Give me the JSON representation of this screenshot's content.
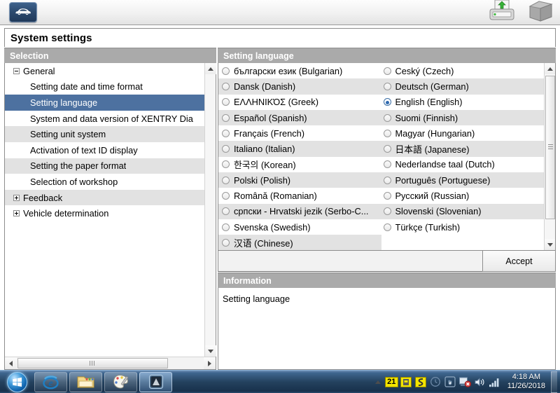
{
  "toolbar": {
    "car_icon": "car-icon",
    "print_icon": "printer-upload-icon",
    "book_icon": "book-icon"
  },
  "page": {
    "title": "System settings"
  },
  "headers": {
    "selection": "Selection",
    "setting_language": "Setting language",
    "information": "Information"
  },
  "tree": {
    "items": [
      {
        "label": "General",
        "level": 0,
        "expander": "minus",
        "selected": false,
        "alt": false
      },
      {
        "label": "Setting date and time format",
        "level": 1,
        "expander": "none",
        "selected": false,
        "alt": false
      },
      {
        "label": "Setting language",
        "level": 1,
        "expander": "none",
        "selected": true,
        "alt": false
      },
      {
        "label": "System and data version of XENTRY Dia",
        "level": 1,
        "expander": "none",
        "selected": false,
        "alt": false
      },
      {
        "label": "Setting unit system",
        "level": 1,
        "expander": "none",
        "selected": false,
        "alt": true
      },
      {
        "label": "Activation of text ID display",
        "level": 1,
        "expander": "none",
        "selected": false,
        "alt": false
      },
      {
        "label": "Setting the paper format",
        "level": 1,
        "expander": "none",
        "selected": false,
        "alt": true
      },
      {
        "label": "Selection of workshop",
        "level": 1,
        "expander": "none",
        "selected": false,
        "alt": false
      },
      {
        "label": "Feedback",
        "level": 0,
        "expander": "plus",
        "selected": false,
        "alt": true
      },
      {
        "label": "Vehicle determination",
        "level": 0,
        "expander": "plus",
        "selected": false,
        "alt": false
      }
    ]
  },
  "languages": {
    "rows": [
      {
        "alt": false,
        "left": {
          "label": "български език (Bulgarian)",
          "selected": false
        },
        "right": {
          "label": "Ceský (Czech)",
          "selected": false
        }
      },
      {
        "alt": true,
        "left": {
          "label": "Dansk (Danish)",
          "selected": false
        },
        "right": {
          "label": "Deutsch (German)",
          "selected": false
        }
      },
      {
        "alt": false,
        "left": {
          "label": "ΕΛΛΗΝΙΚΌΣ (Greek)",
          "selected": false
        },
        "right": {
          "label": "English (English)",
          "selected": true
        }
      },
      {
        "alt": true,
        "left": {
          "label": "Español (Spanish)",
          "selected": false
        },
        "right": {
          "label": "Suomi (Finnish)",
          "selected": false
        }
      },
      {
        "alt": false,
        "left": {
          "label": "Français (French)",
          "selected": false
        },
        "right": {
          "label": "Magyar (Hungarian)",
          "selected": false
        }
      },
      {
        "alt": true,
        "left": {
          "label": "Italiano (Italian)",
          "selected": false
        },
        "right": {
          "label": "日本語 (Japanese)",
          "selected": false
        }
      },
      {
        "alt": false,
        "left": {
          "label": "한국의 (Korean)",
          "selected": false
        },
        "right": {
          "label": "Nederlandse taal (Dutch)",
          "selected": false
        }
      },
      {
        "alt": true,
        "left": {
          "label": "Polski (Polish)",
          "selected": false
        },
        "right": {
          "label": "Português (Portuguese)",
          "selected": false
        }
      },
      {
        "alt": false,
        "left": {
          "label": "Română (Romanian)",
          "selected": false
        },
        "right": {
          "label": "Русский (Russian)",
          "selected": false
        }
      },
      {
        "alt": true,
        "left": {
          "label": "српски - Hrvatski jezik (Serbo-C...",
          "selected": false
        },
        "right": {
          "label": "Slovenski (Slovenian)",
          "selected": false
        }
      },
      {
        "alt": false,
        "left": {
          "label": "Svenska (Swedish)",
          "selected": false
        },
        "right": {
          "label": "Türkçe (Turkish)",
          "selected": false
        }
      },
      {
        "alt": true,
        "left": {
          "label": "汉语 (Chinese)",
          "selected": false
        },
        "right": {
          "label": "",
          "selected": null
        }
      }
    ]
  },
  "accept": {
    "label": "Accept"
  },
  "information": {
    "text": "Setting language"
  },
  "taskbar": {
    "start": "windows-start-orb",
    "buttons": [
      {
        "name": "taskbar-item-internet-explorer",
        "icon": "internet-explorer-icon",
        "active": false
      },
      {
        "name": "taskbar-item-explorer",
        "icon": "folder-explorer-icon",
        "active": false
      },
      {
        "name": "taskbar-item-paint",
        "icon": "paint-palette-icon",
        "active": false
      },
      {
        "name": "taskbar-item-xentry",
        "icon": "xentry-app-icon",
        "active": true
      }
    ],
    "tray": {
      "badge_count": "21",
      "icons": [
        "calendar-badge-icon",
        "yellow-app-icon",
        "yellow-app2-icon",
        "clock-icon",
        "hand-shield-icon",
        "network-warning-icon",
        "volume-icon",
        "signal-bars-icon"
      ],
      "time": "4:18 AM",
      "date": "11/26/2018"
    }
  },
  "colors": {
    "header_gray": "#aaaaaa",
    "tree_selected_blue": "#4d71a0",
    "alt_row": "#e2e2e2",
    "radio_accent": "#2f6ab0",
    "taskbar": "#24425f"
  }
}
